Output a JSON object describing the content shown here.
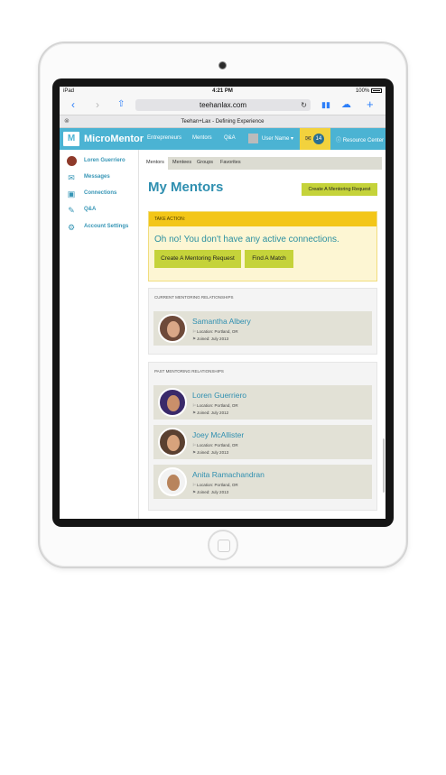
{
  "status_bar": {
    "device": "iPad",
    "time": "4:21 PM",
    "battery": "100%"
  },
  "browser": {
    "url": "teehanlax.com",
    "tab_title": "Teehan+Lax - Defining Experience"
  },
  "app": {
    "brand": "MicroMentor",
    "logo_glyph": "M",
    "nav": [
      "Entrepreneurs",
      "Mentors",
      "Q&A"
    ],
    "user_label": "User Name",
    "message_count": "14",
    "resource_center": "Resource Center"
  },
  "sidebar": {
    "items": [
      {
        "label": "Loren Guerriero",
        "icon": "user-avatar"
      },
      {
        "label": "Messages",
        "icon": "envelope-icon"
      },
      {
        "label": "Connections",
        "icon": "connections-icon"
      },
      {
        "label": "Q&A",
        "icon": "chat-bubbles-icon"
      },
      {
        "label": "Account Settings",
        "icon": "gear-icon"
      }
    ]
  },
  "main": {
    "tabs": [
      "Mentors",
      "Mentees",
      "Groups",
      "Favorites"
    ],
    "active_tab": "Mentors",
    "title": "My Mentors",
    "create_button": "Create A Mentoring Request",
    "action_panel": {
      "heading": "TAKE ACTION:",
      "message": "Oh no! You don't have any active connections.",
      "buttons": [
        "Create A Mentoring Request",
        "Find A Match"
      ]
    },
    "current": {
      "heading": "CURRENT MENTORING RELATIONSHIPS",
      "people": [
        {
          "name": "Samantha Albery",
          "location": "Location: Portland, OR",
          "joined": "Joined: July 2013"
        }
      ]
    },
    "past": {
      "heading": "PAST MENTORING RELATIONSHIPS",
      "people": [
        {
          "name": "Loren Guerriero",
          "location": "Location: Portland, OR",
          "joined": "Joined: July 2012"
        },
        {
          "name": "Joey McAllister",
          "location": "Location: Portland, OR",
          "joined": "Joined: July 2013"
        },
        {
          "name": "Anita Ramachandran",
          "location": "Location: Portland, OR",
          "joined": "Joined: July 2013"
        }
      ]
    }
  },
  "colors": {
    "nav_blue": "#4bb3d3",
    "accent_green": "#c5d33a",
    "alert_yellow": "#f3c618",
    "card_beige": "#e2e1d6",
    "link_blue": "#2f8fb0"
  }
}
